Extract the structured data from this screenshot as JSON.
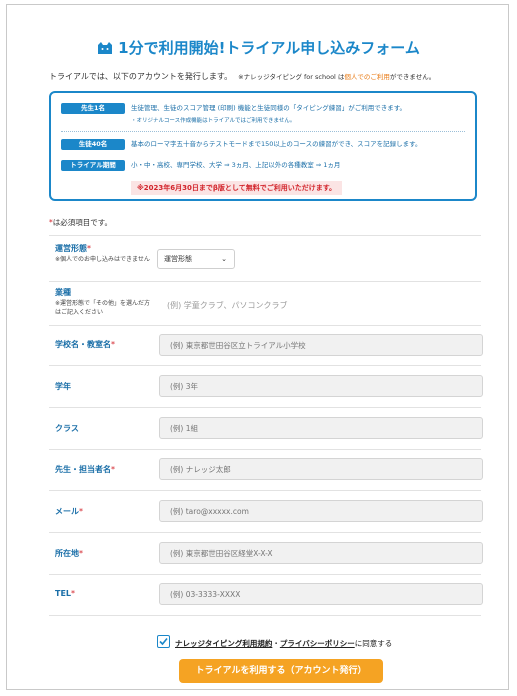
{
  "header": {
    "title": "1分で利用開始!トライアル申し込みフォーム"
  },
  "intro": {
    "text": "トライアルでは、以下のアカウントを発行します。",
    "note_prefix": "※ナレッジタイピング for school は",
    "note_highlight": "個人でのご利用",
    "note_suffix": "ができません。"
  },
  "info_box": {
    "rows": [
      {
        "badge": "先生1名",
        "text": "生徒管理、生徒のスコア管理 (印刷) 機能と生徒同様の「タイピング練習」がご利用できます。",
        "sub": "・オリジナルコース作成機能はトライアルではご利用できません。"
      },
      {
        "badge": "生徒40名",
        "text": "基本のローマ字五十音からテストモードまで150以上のコースの練習ができ、スコアを記録します。"
      },
      {
        "badge": "トライアル期間",
        "text": "小・中・高校、専門学校、大学 ⇒ 3ヵ月、上記以外の各種教室 ⇒ 1ヵ月"
      }
    ],
    "notice": "※2023年6月30日までβ版として無料でご利用いただけます。"
  },
  "required_note": {
    "star": "*",
    "text": "は必須項目です。"
  },
  "form": {
    "type": {
      "label": "運営形態",
      "hint": "※個人でのお申し込みはできません",
      "value": "運営形態"
    },
    "industry": {
      "label": "業種",
      "hint": "※運営形態で「その他」を選んだ方はご記入ください",
      "placeholder": "(例) 学童クラブ、パソコンクラブ"
    },
    "school": {
      "label": "学校名・教室名",
      "placeholder": "(例) 東京都世田谷区立トライアル小学校"
    },
    "grade": {
      "label": "学年",
      "placeholder": "(例) 3年"
    },
    "class": {
      "label": "クラス",
      "placeholder": "(例) 1組"
    },
    "teacher": {
      "label": "先生・担当者名",
      "placeholder": "(例) ナレッジ太郎"
    },
    "email": {
      "label": "メール",
      "placeholder": "(例) taro@xxxxx.com"
    },
    "address": {
      "label": "所在地",
      "placeholder": "(例) 東京都世田谷区経堂X-X-X"
    },
    "tel": {
      "label": "TEL",
      "placeholder": "(例) 03-3333-XXXX"
    },
    "star": "*"
  },
  "agreement": {
    "terms_link": "ナレッジタイピング利用規約",
    "separator": "・",
    "privacy_link": "プライバシーポリシー",
    "suffix": "に同意する",
    "checked": true
  },
  "submit": {
    "label": "トライアルを利用する（アカウント発行）"
  },
  "colors": {
    "brand": "#1b87c9",
    "accent": "#f5a323",
    "required": "#d2232a",
    "highlight": "#e97a14"
  }
}
